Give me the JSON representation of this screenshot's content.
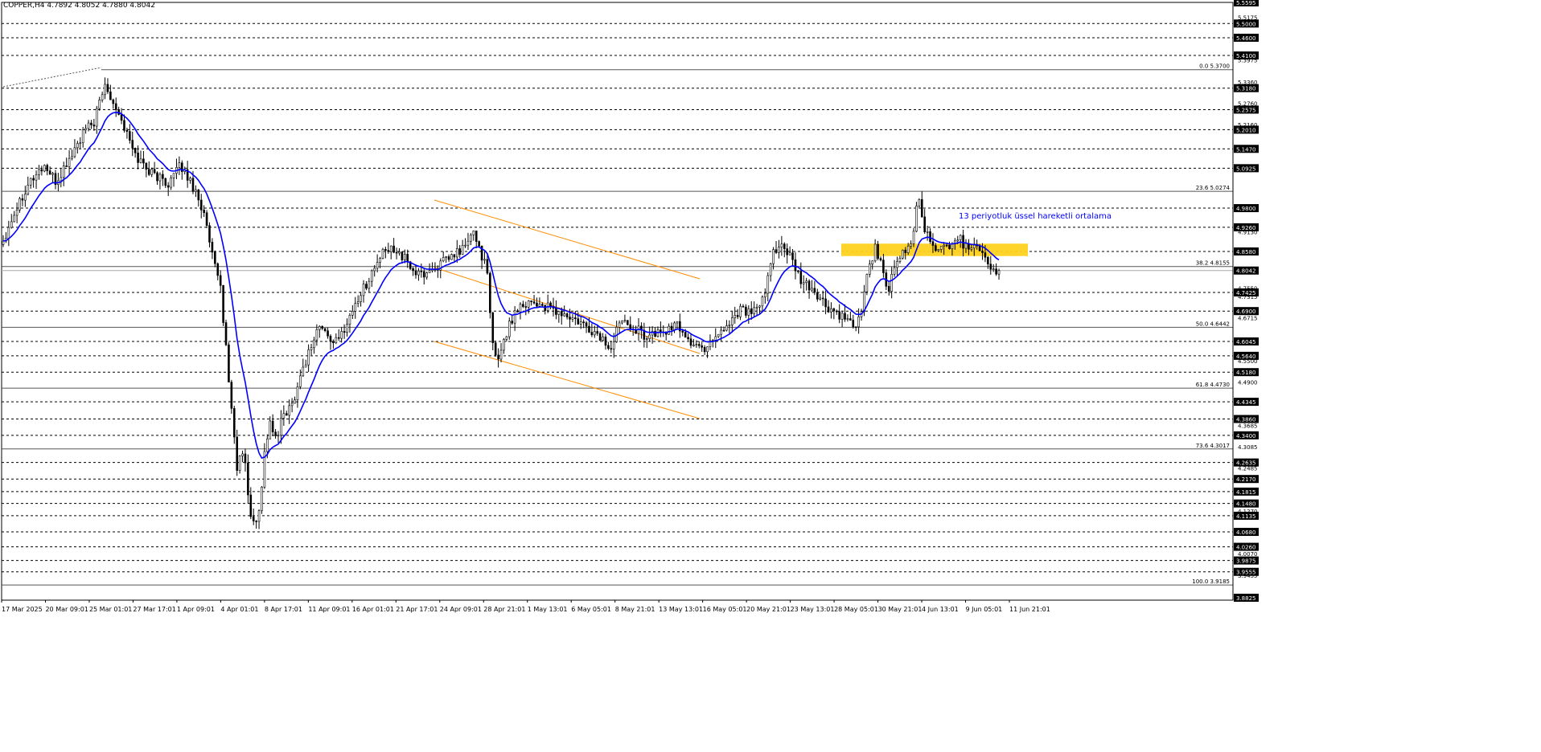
{
  "header": {
    "title": "COPPER,H4  4.7892 4.8052 4.7880 4.8042"
  },
  "annotation": "13 periyotluk üssel hareketli ortalama",
  "colors": {
    "ema": "#0000ff",
    "channel": "#ff8c00",
    "zone": "#ffd21f",
    "candle": "#000000",
    "label_bg": "#000000"
  },
  "chart_data": {
    "type": "candlestick",
    "symbol": "COPPER",
    "timeframe": "H4",
    "ohlc_last": {
      "open": 4.7892,
      "high": 4.8052,
      "low": 4.788,
      "close": 4.8042
    },
    "ylim": [
      3.8825,
      5.5595
    ],
    "x_labels": [
      "17 Mar 2025",
      "20 Mar 09:01",
      "25 Mar 01:01",
      "27 Mar 17:01",
      "1 Apr 09:01",
      "4 Apr 01:01",
      "8 Apr 17:01",
      "11 Apr 09:01",
      "16 Apr 01:01",
      "21 Apr 17:01",
      "24 Apr 09:01",
      "28 Apr 21:01",
      "1 May 13:01",
      "6 May 05:01",
      "8 May 21:01",
      "13 May 13:01",
      "16 May 05:01",
      "20 May 21:01",
      "23 May 13:01",
      "28 May 05:01",
      "30 May 21:01",
      "4 Jun 13:01",
      "9 Jun 05:01",
      "11 Jun 21:01"
    ],
    "y_tick_labels": [
      "5.5595",
      "5.5000",
      "5.4600",
      "5.4100",
      "5.3180",
      "5.2575",
      "5.2010",
      "5.1470",
      "5.0925",
      "4.9800",
      "4.9260",
      "4.8580",
      "4.8042",
      "4.7425",
      "4.6900",
      "4.6045",
      "4.5640",
      "4.5180",
      "4.4345",
      "4.3860",
      "4.3400",
      "4.2635",
      "4.2170",
      "4.1815",
      "4.1480",
      "4.1135",
      "4.0680",
      "4.0260",
      "3.9875",
      "3.9555",
      "3.8825"
    ],
    "y_small_labels": [
      "5.5175",
      "5.3975",
      "5.3360",
      "5.2760",
      "5.2160",
      "4.9130",
      "4.7550",
      "4.7315",
      "4.6715",
      "4.5500",
      "4.4900",
      "4.3685",
      "4.3085",
      "4.2485",
      "4.1270",
      "4.0070",
      "3.9455"
    ],
    "horizontal_levels": [
      5.5,
      5.46,
      5.41,
      5.318,
      5.2575,
      5.201,
      5.147,
      5.0925,
      4.98,
      4.926,
      4.858,
      4.7425,
      4.69,
      4.6045,
      4.564,
      4.518,
      4.4345,
      4.386,
      4.34,
      4.2635,
      4.217,
      4.1815,
      4.148,
      4.1135,
      4.068,
      4.026,
      3.9875,
      3.9555
    ],
    "fibonacci": [
      {
        "label": "0.0 5.3700",
        "price": 5.37
      },
      {
        "label": "23.6 5.0274",
        "price": 5.0274
      },
      {
        "label": "38.2 4.8155",
        "price": 4.8155
      },
      {
        "label": "50.0 4.6442",
        "price": 4.6442
      },
      {
        "label": "61.8 4.4730",
        "price": 4.473
      },
      {
        "label": "73.6 4.3017",
        "price": 4.3017
      },
      {
        "label": "100.0 3.9185",
        "price": 3.9185
      }
    ],
    "current_price": 4.8042,
    "bars_total": 363,
    "close_path": [
      [
        0,
        4.89
      ],
      [
        5,
        4.95
      ],
      [
        15,
        5.05
      ],
      [
        25,
        5.1
      ],
      [
        32,
        5.05
      ],
      [
        38,
        5.1
      ],
      [
        50,
        5.2
      ],
      [
        55,
        5.22
      ],
      [
        62,
        5.33
      ],
      [
        70,
        5.25
      ],
      [
        80,
        5.13
      ],
      [
        90,
        5.08
      ],
      [
        100,
        5.05
      ],
      [
        108,
        5.1
      ],
      [
        118,
        5.02
      ],
      [
        122,
        4.96
      ],
      [
        128,
        4.82
      ],
      [
        132,
        4.76
      ],
      [
        136,
        4.55
      ],
      [
        139,
        4.4
      ],
      [
        142,
        4.25
      ],
      [
        146,
        4.3
      ],
      [
        150,
        4.12
      ],
      [
        153,
        4.08
      ],
      [
        156,
        4.15
      ],
      [
        159,
        4.3
      ],
      [
        162,
        4.38
      ],
      [
        166,
        4.32
      ],
      [
        170,
        4.4
      ],
      [
        175,
        4.42
      ],
      [
        180,
        4.5
      ],
      [
        186,
        4.58
      ],
      [
        192,
        4.65
      ],
      [
        197,
        4.62
      ],
      [
        203,
        4.6
      ],
      [
        208,
        4.65
      ],
      [
        215,
        4.72
      ],
      [
        222,
        4.78
      ],
      [
        230,
        4.85
      ],
      [
        238,
        4.87
      ],
      [
        245,
        4.83
      ],
      [
        252,
        4.79
      ],
      [
        258,
        4.8
      ],
      [
        265,
        4.82
      ],
      [
        272,
        4.84
      ],
      [
        280,
        4.87
      ],
      [
        286,
        4.91
      ],
      [
        290,
        4.86
      ],
      [
        294,
        4.8
      ],
      [
        297,
        4.6
      ],
      [
        300,
        4.55
      ],
      [
        305,
        4.62
      ],
      [
        312,
        4.7
      ],
      [
        320,
        4.72
      ],
      [
        330,
        4.7
      ],
      [
        340,
        4.68
      ],
      [
        348,
        4.66
      ],
      [
        355,
        4.64
      ],
      [
        362,
        4.62
      ],
      [
        370,
        4.58
      ],
      [
        375,
        4.68
      ],
      [
        382,
        4.65
      ],
      [
        390,
        4.62
      ],
      [
        400,
        4.63
      ],
      [
        410,
        4.65
      ],
      [
        418,
        4.6
      ],
      [
        425,
        4.58
      ],
      [
        432,
        4.62
      ],
      [
        440,
        4.65
      ],
      [
        448,
        4.7
      ],
      [
        455,
        4.68
      ],
      [
        462,
        4.72
      ],
      [
        468,
        4.86
      ],
      [
        472,
        4.88
      ],
      [
        478,
        4.84
      ],
      [
        485,
        4.77
      ],
      [
        492,
        4.75
      ],
      [
        500,
        4.7
      ],
      [
        507,
        4.68
      ],
      [
        515,
        4.65
      ],
      [
        520,
        4.66
      ],
      [
        525,
        4.8
      ],
      [
        530,
        4.87
      ],
      [
        534,
        4.82
      ],
      [
        537,
        4.73
      ],
      [
        541,
        4.8
      ],
      [
        546,
        4.85
      ],
      [
        552,
        4.88
      ],
      [
        556,
        5.02
      ],
      [
        560,
        4.92
      ],
      [
        564,
        4.88
      ],
      [
        570,
        4.86
      ],
      [
        575,
        4.88
      ],
      [
        580,
        4.9
      ],
      [
        585,
        4.87
      ],
      [
        590,
        4.88
      ],
      [
        596,
        4.86
      ],
      [
        600,
        4.8
      ],
      [
        605,
        4.8
      ]
    ]
  }
}
